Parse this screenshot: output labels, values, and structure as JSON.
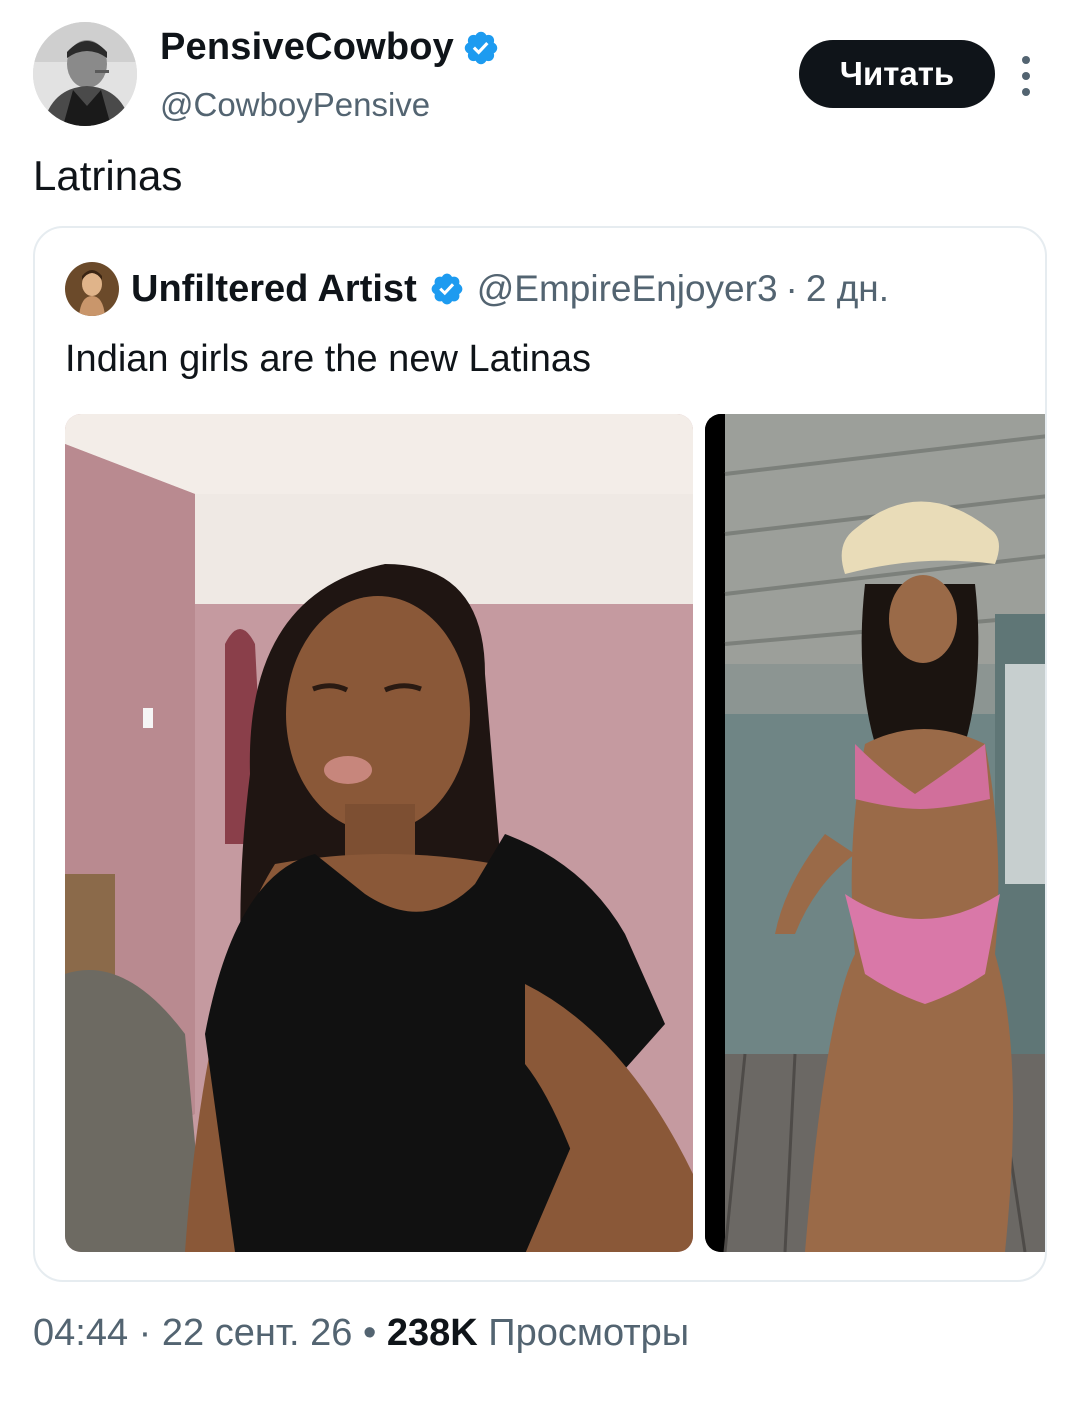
{
  "author": {
    "display_name": "PensiveCowboy",
    "handle": "@CowboyPensive",
    "avatar_icon": "avatar-portrait",
    "verified": true
  },
  "follow_button": {
    "label": "Читать"
  },
  "tweet": {
    "text": "Latrinas"
  },
  "quoted_tweet": {
    "display_name": "Unfiltered Artist",
    "handle": "@EmpireEnjoyer3",
    "separator": "·",
    "age": "2 дн.",
    "text": "Indian girls are the new Latinas",
    "media": [
      {
        "description_icon": "photo-1"
      },
      {
        "description_icon": "photo-2"
      }
    ]
  },
  "footer": {
    "time": "04:44",
    "sep1": "·",
    "date": "22 сент. 26",
    "sep2": "•",
    "views_count": "238K",
    "views_label": "Просмотры"
  },
  "colors": {
    "verified_blue": "#1d9bf0",
    "text_primary": "#0f1419",
    "text_secondary": "#536471",
    "button_bg": "#0f1419"
  }
}
